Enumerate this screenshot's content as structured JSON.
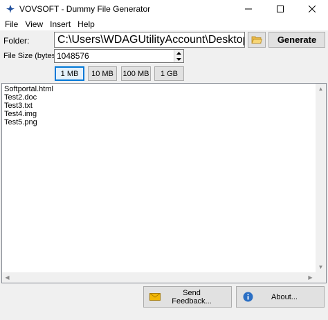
{
  "window": {
    "title": "VOVSOFT - Dummy File Generator",
    "icons": {
      "app": "app-icon",
      "minimize": "minimize-icon",
      "maximize": "maximize-icon",
      "close": "close-icon"
    }
  },
  "menu": {
    "items": [
      {
        "label": "File"
      },
      {
        "label": "View"
      },
      {
        "label": "Insert"
      },
      {
        "label": "Help"
      }
    ]
  },
  "folder": {
    "label": "Folder:",
    "value": "C:\\Users\\WDAGUtilityAccount\\Desktop",
    "browse_icon": "folder-open-icon"
  },
  "generate": {
    "label": "Generate"
  },
  "file_size": {
    "label": "File Size (bytes):",
    "value": "1048576"
  },
  "presets": [
    {
      "label": "1 MB",
      "selected": true
    },
    {
      "label": "10 MB",
      "selected": false
    },
    {
      "label": "100 MB",
      "selected": false
    },
    {
      "label": "1 GB",
      "selected": false
    }
  ],
  "file_list": {
    "items": [
      "Softportal.html",
      "Test2.doc",
      "Test3.txt",
      "Test4.img",
      "Test5.png"
    ]
  },
  "footer": {
    "feedback": {
      "label": "Send Feedback...",
      "icon": "envelope-icon"
    },
    "about": {
      "label": "About...",
      "icon": "info-icon"
    }
  },
  "colors": {
    "accent": "#0078d7",
    "button_face": "#e1e1e1",
    "window_bg": "#f0f0f0"
  }
}
